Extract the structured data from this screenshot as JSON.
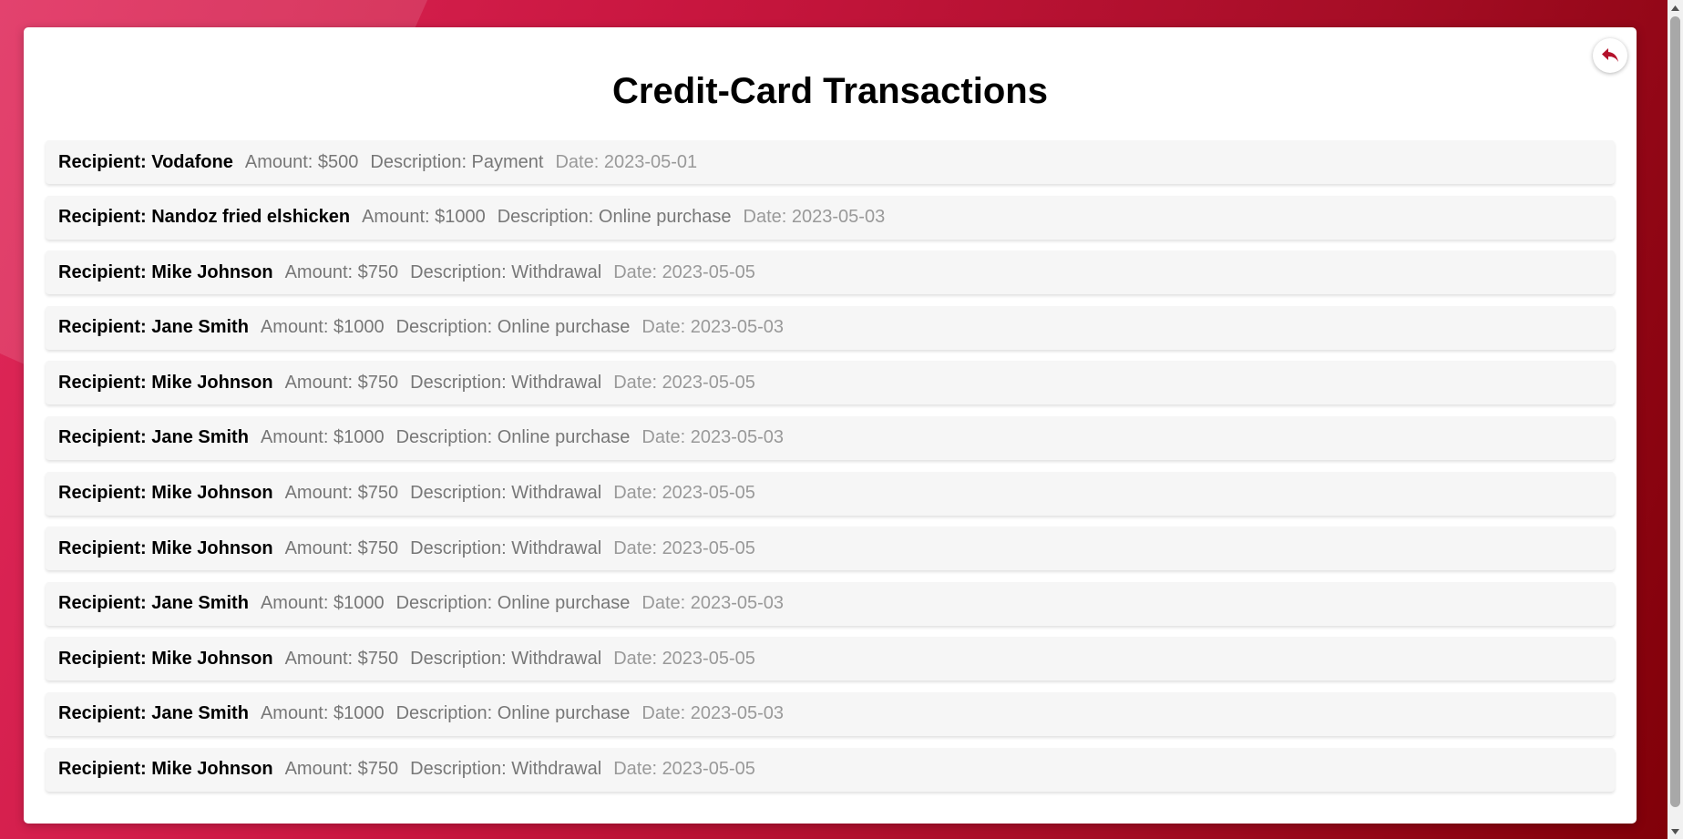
{
  "colors": {
    "accent": "#b3112b",
    "background_start": "#e0285a",
    "background_end": "#800008"
  },
  "header": {
    "title": "Credit-Card Transactions",
    "back_icon": "reply-arrow-icon"
  },
  "transactions": [
    {
      "recipient": "Recipient: Vodafone",
      "amount": "Amount: $500",
      "description": "Description: Payment",
      "date": "Date: 2023-05-01"
    },
    {
      "recipient": "Recipient: Nandoz fried elshicken",
      "amount": "Amount: $1000",
      "description": "Description: Online purchase",
      "date": "Date: 2023-05-03"
    },
    {
      "recipient": "Recipient: Mike Johnson",
      "amount": "Amount: $750",
      "description": "Description: Withdrawal",
      "date": "Date: 2023-05-05"
    },
    {
      "recipient": "Recipient: Jane Smith",
      "amount": "Amount: $1000",
      "description": "Description: Online purchase",
      "date": "Date: 2023-05-03"
    },
    {
      "recipient": "Recipient: Mike Johnson",
      "amount": "Amount: $750",
      "description": "Description: Withdrawal",
      "date": "Date: 2023-05-05"
    },
    {
      "recipient": "Recipient: Jane Smith",
      "amount": "Amount: $1000",
      "description": "Description: Online purchase",
      "date": "Date: 2023-05-03"
    },
    {
      "recipient": "Recipient: Mike Johnson",
      "amount": "Amount: $750",
      "description": "Description: Withdrawal",
      "date": "Date: 2023-05-05"
    },
    {
      "recipient": "Recipient: Mike Johnson",
      "amount": "Amount: $750",
      "description": "Description: Withdrawal",
      "date": "Date: 2023-05-05"
    },
    {
      "recipient": "Recipient: Jane Smith",
      "amount": "Amount: $1000",
      "description": "Description: Online purchase",
      "date": "Date: 2023-05-03"
    },
    {
      "recipient": "Recipient: Mike Johnson",
      "amount": "Amount: $750",
      "description": "Description: Withdrawal",
      "date": "Date: 2023-05-05"
    },
    {
      "recipient": "Recipient: Jane Smith",
      "amount": "Amount: $1000",
      "description": "Description: Online purchase",
      "date": "Date: 2023-05-03"
    },
    {
      "recipient": "Recipient: Mike Johnson",
      "amount": "Amount: $750",
      "description": "Description: Withdrawal",
      "date": "Date: 2023-05-05"
    }
  ]
}
